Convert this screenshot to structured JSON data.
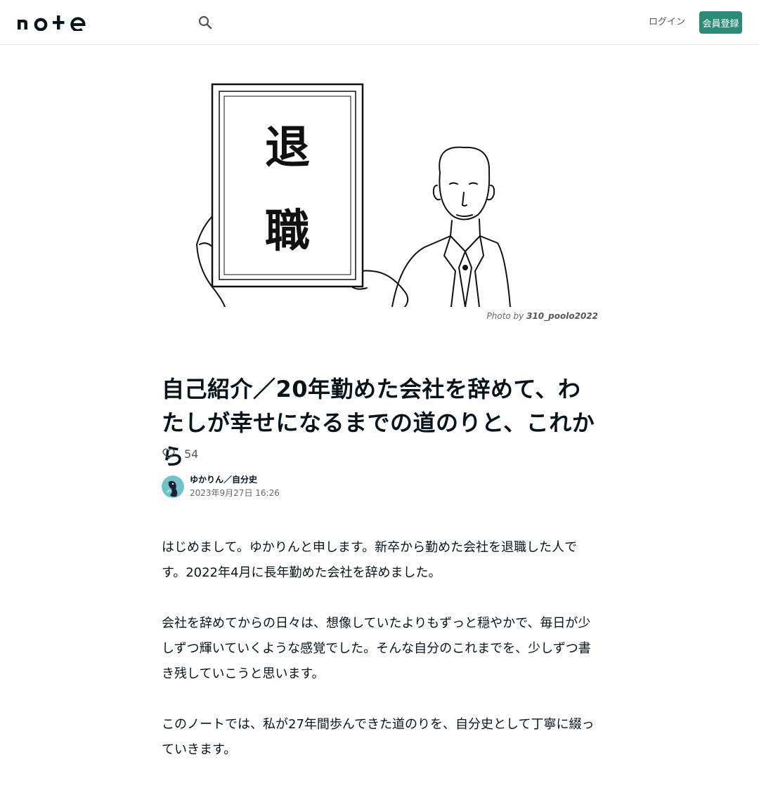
{
  "header": {
    "logo_icon": "note-logo",
    "search_icon": "search-icon",
    "login_label": "ログイン",
    "signup_label": "会員登録",
    "accent_color": "#2b8b79"
  },
  "eyecatch": {
    "sign_char_1": "退",
    "sign_char_2": "職",
    "credit_prefix": "Photo by",
    "credit_author": "310_poolo2022"
  },
  "article": {
    "title": "自己紹介／20年勤めた会社を辞めて、わたしが幸せになるまでの道のりと、これから",
    "like_count": "54",
    "author_name": "ゆかりん／自分史",
    "post_date": "2023年9月27日 16:26",
    "paragraphs": [
      "はじめまして。ゆかりんと申します。新卒から勤めた会社を退職した人です。2022年4月に長年勤めた会社を辞めました。",
      "会社を辞めてからの日々は、想像していたよりもずっと穏やかで、毎日が少しずつ輝いていくような感覚でした。そんな自分のこれまでを、少しずつ書き残していこうと思います。",
      "このノートでは、私が27年間歩んできた道のりを、自分史として丁寧に綴っていきます。"
    ]
  }
}
